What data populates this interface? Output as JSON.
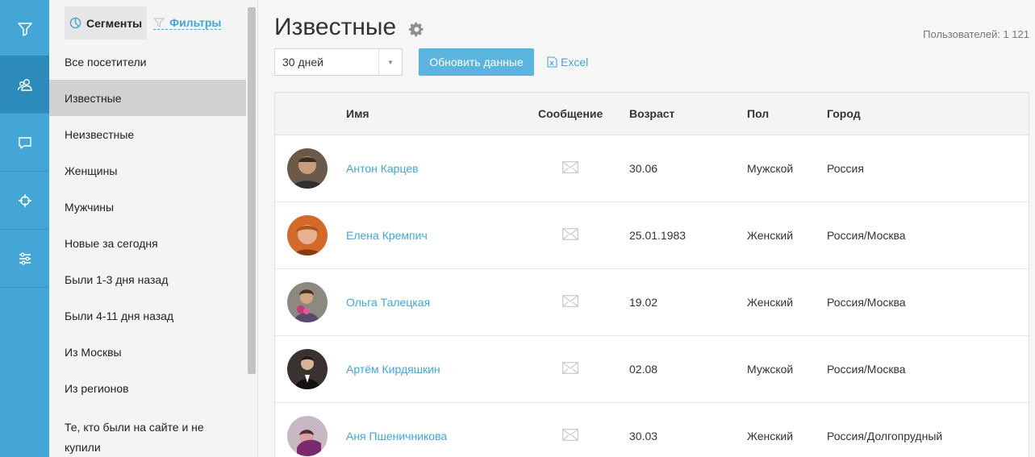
{
  "rail": {
    "items": [
      {
        "icon": "funnel-icon",
        "active": false
      },
      {
        "icon": "users-icon",
        "active": true
      },
      {
        "icon": "chat-icon",
        "active": false
      },
      {
        "icon": "target-icon",
        "active": false
      },
      {
        "icon": "sliders-icon",
        "active": false
      }
    ]
  },
  "panel": {
    "tab_segments": "Сегменты",
    "tab_filters": "Фильтры",
    "items": [
      {
        "label": "Все посетители"
      },
      {
        "label": "Известные"
      },
      {
        "label": "Неизвестные"
      },
      {
        "label": "Женщины"
      },
      {
        "label": "Мужчины"
      },
      {
        "label": "Новые за сегодня"
      },
      {
        "label": "Были 1-3 дня назад"
      },
      {
        "label": "Были 4-11 дня назад"
      },
      {
        "label": "Из Москвы"
      },
      {
        "label": "Из регионов"
      },
      {
        "label": "Те, кто были на сайте и не купили"
      }
    ]
  },
  "main": {
    "title": "Известные",
    "users_count": "Пользователей: 1 121",
    "period": "30 дней",
    "refresh_label": "Обновить данные",
    "excel_label": "Excel"
  },
  "table": {
    "headers": {
      "name": "Имя",
      "message": "Сообщение",
      "age": "Возраст",
      "gender": "Пол",
      "city": "Город"
    },
    "rows": [
      {
        "name": "Антон Карцев",
        "age": "30.06",
        "gender": "Мужской",
        "city": "Россия"
      },
      {
        "name": "Елена Кремпич",
        "age": "25.01.1983",
        "gender": "Женский",
        "city": "Россия/Москва"
      },
      {
        "name": "Ольга Талецкая",
        "age": "19.02",
        "gender": "Женский",
        "city": "Россия/Москва"
      },
      {
        "name": "Артём Кирдяшкин",
        "age": "02.08",
        "gender": "Мужской",
        "city": "Россия/Москва"
      },
      {
        "name": "Аня Пшеничникова",
        "age": "30.03",
        "gender": "Женский",
        "city": "Россия/Долгопрудный"
      }
    ]
  },
  "colors": {
    "accent": "#43a6d6",
    "rail_active": "#2d8bbb",
    "button": "#5bb4de"
  }
}
